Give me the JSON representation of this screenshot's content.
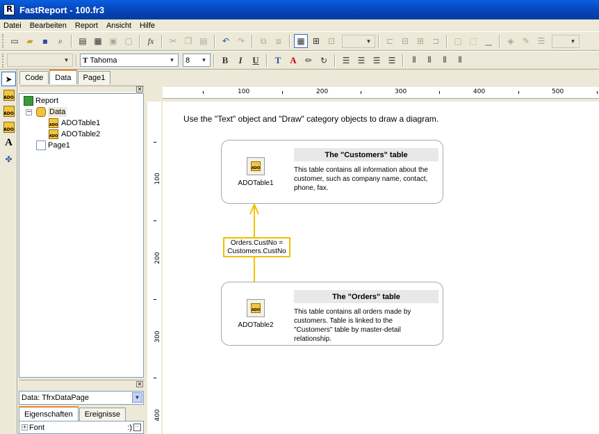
{
  "window": {
    "title": "FastReport - 100.fr3"
  },
  "menu": [
    "Datei",
    "Bearbeiten",
    "Report",
    "Ansicht",
    "Hilfe"
  ],
  "toolbar2": {
    "font_name": "Tahoma",
    "font_size": "8"
  },
  "left_panel": {
    "tabs": [
      "Code",
      "Data",
      "Page1"
    ],
    "active_tab": "Data",
    "tree": {
      "report": "Report",
      "data": "Data",
      "table1": "ADOTable1",
      "table2": "ADOTable2",
      "page": "Page1"
    },
    "object_combo": "Data: TfrxDataPage",
    "prop_tabs": [
      "Eigenschaften",
      "Ereignisse"
    ],
    "prop_row": {
      "expander": "+",
      "name": "Font",
      "value": ":)"
    }
  },
  "ruler": {
    "h_labels": [
      "100",
      "200",
      "300",
      "400",
      "500"
    ],
    "v_labels": [
      "100",
      "200",
      "300",
      "400"
    ]
  },
  "page": {
    "hint": "Use the \"Text\" object and \"Draw\" category objects to draw a diagram.",
    "customers": {
      "component": "ADOTable1",
      "header": "The \"Customers\" table",
      "description": "This table contains all information about the customer, such as company name, contact, phone, fax."
    },
    "orders": {
      "component": "ADOTable2",
      "header": "The \"Orders\" table",
      "description": "This table contains all orders made by customers. Table is linked to the \"Customers\" table by master-detail relationship."
    },
    "relation": {
      "line1": "Orders.CustNo =",
      "line2": "Customers.CustNo"
    },
    "colors": {
      "relation": "#f0c000",
      "title_bar": "#0a5fe0"
    }
  },
  "icons": {
    "toolstrip": [
      "arrow-icon",
      "ado-table-icon",
      "ado-query-icon",
      "ado-database-icon",
      "text-icon",
      "tools-icon"
    ]
  }
}
